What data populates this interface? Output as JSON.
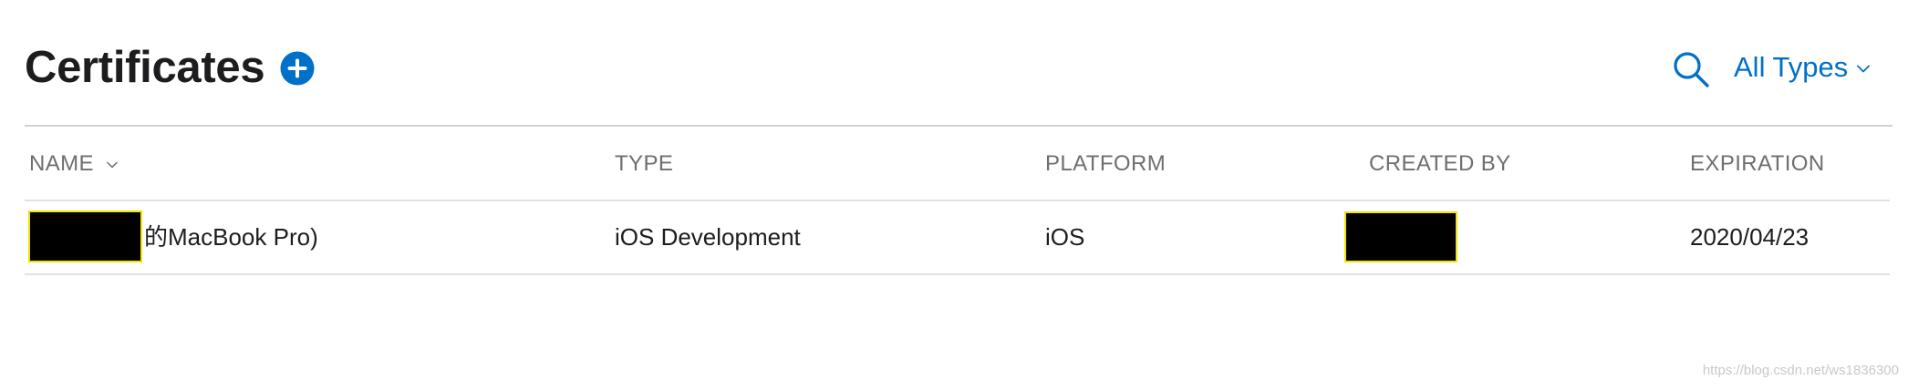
{
  "header": {
    "title": "Certificates",
    "add_icon": "plus-circle-icon",
    "search_icon": "search-icon",
    "filter_label": "All Types",
    "filter_icon": "chevron-down-icon"
  },
  "table": {
    "columns": [
      "NAME",
      "TYPE",
      "PLATFORM",
      "CREATED BY",
      "EXPIRATION"
    ],
    "sort_icon": "chevron-down-icon",
    "rows": [
      {
        "name": "的MacBook Pro)",
        "type": "iOS Development",
        "platform": "iOS",
        "expiration": "2020/04/23"
      }
    ]
  },
  "watermark": "https://blog.csdn.net/ws1836300",
  "colors": {
    "accent": "#0070c9",
    "text": "#1d1d1f",
    "header_text": "#6e6e73",
    "divider": "#d2d2d7",
    "redaction": "#000000",
    "redaction_border": "#f2e200"
  }
}
